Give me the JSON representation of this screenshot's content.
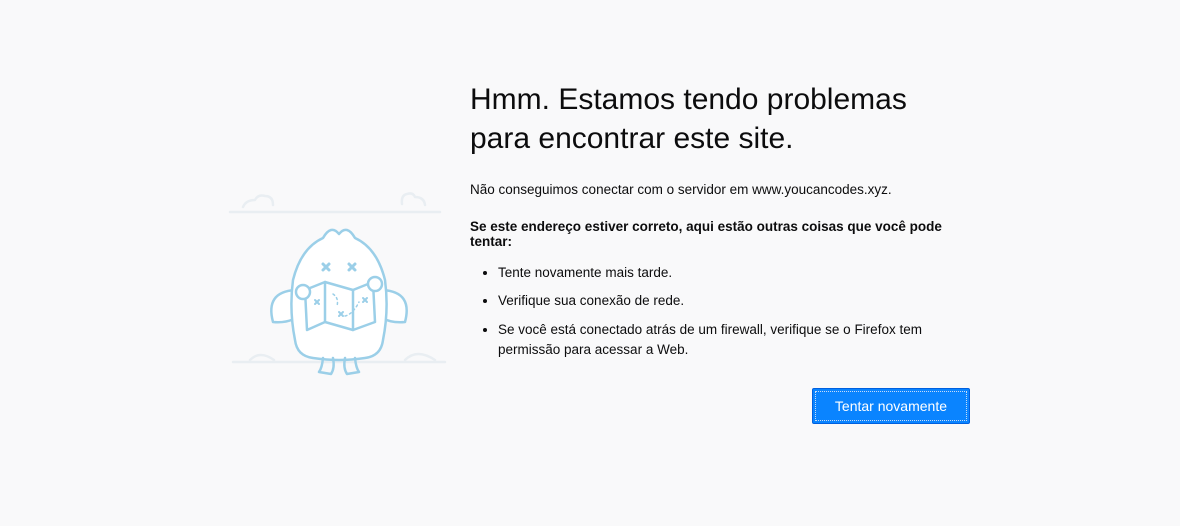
{
  "title": "Hmm. Estamos tendo problemas para encontrar este site.",
  "description": "Não conseguimos conectar com o servidor em www.youcancodes.xyz.",
  "strong_line": "Se este endereço estiver correto, aqui estão outras coisas que você pode tentar:",
  "suggestions": [
    "Tente novamente mais tarde.",
    "Verifique sua conexão de rede.",
    "Se você está conectado atrás de um firewall, verifique se o Firefox tem permissão para acessar a Web."
  ],
  "retry_button": "Tentar novamente"
}
